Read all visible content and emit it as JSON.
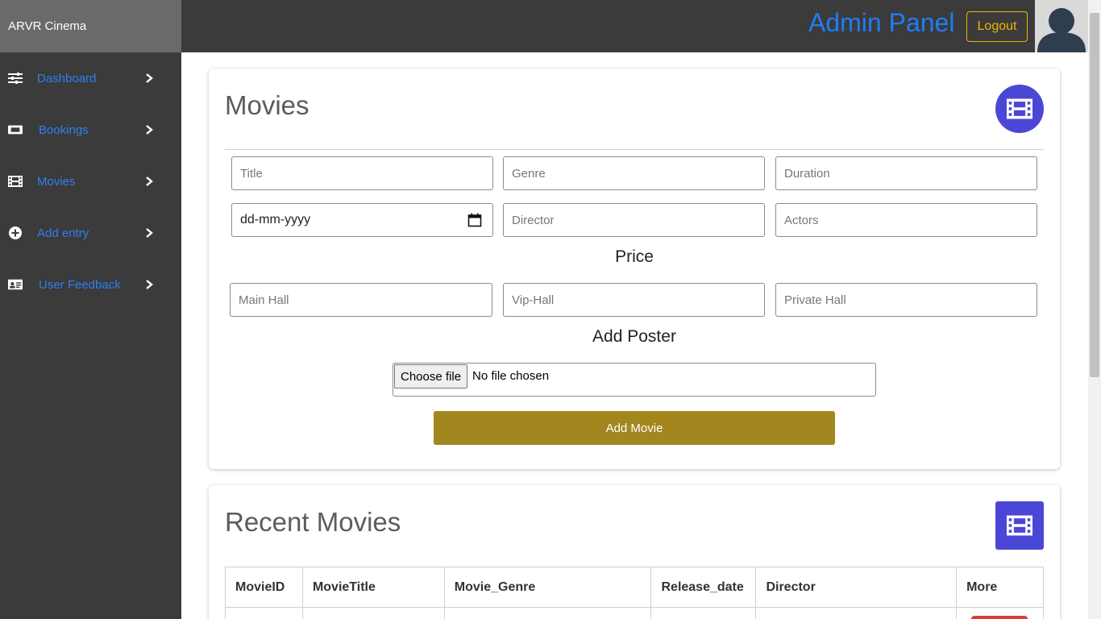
{
  "app": {
    "brand": "ARVR Cinema"
  },
  "sidebar": {
    "items": [
      {
        "label": "Dashboard",
        "icon": "sliders-icon"
      },
      {
        "label": "Bookings",
        "icon": "ticket-icon"
      },
      {
        "label": "Movies",
        "icon": "film-icon"
      },
      {
        "label": "Add entry",
        "icon": "plus-circle-icon"
      },
      {
        "label": "User Feedback",
        "icon": "id-card-icon"
      }
    ]
  },
  "header": {
    "title": "Admin Panel",
    "logout_label": "Logout"
  },
  "movies_form": {
    "title": "Movies",
    "title_placeholder": "Title",
    "genre_placeholder": "Genre",
    "duration_placeholder": "Duration",
    "date_value": "dd-mm-yyyy",
    "director_placeholder": "Director",
    "actors_placeholder": "Actors",
    "price_label": "Price",
    "main_hall_placeholder": "Main Hall",
    "vip_hall_placeholder": "Vip-Hall",
    "private_hall_placeholder": "Private Hall",
    "poster_label": "Add Poster",
    "choose_file_label": "Choose file",
    "file_status": "No file chosen",
    "submit_label": "Add Movie"
  },
  "recent_movies": {
    "title": "Recent Movies",
    "columns": [
      "MovieID",
      "MovieTitle",
      "Movie_Genre",
      "Release_date",
      "Director",
      "More"
    ]
  },
  "colors": {
    "sidebar_bg": "#3b3b3b",
    "brand_bg": "#6a6a6a",
    "link": "#2f7ff0",
    "header_title": "#1e7ef5",
    "logout": "#f0b400",
    "icon_badge": "#4a47d6",
    "submit_button": "#a3861e"
  }
}
